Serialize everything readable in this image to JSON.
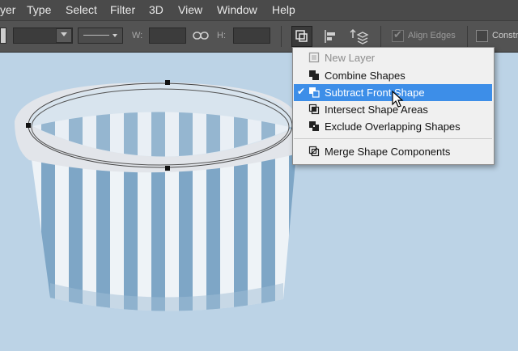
{
  "menubar": {
    "items": [
      "yer",
      "Type",
      "Select",
      "Filter",
      "3D",
      "View",
      "Window",
      "Help"
    ]
  },
  "options_bar": {
    "w_label": "W:",
    "h_label": "H:",
    "align_edges_label": "Align Edges",
    "align_edges_checked": true,
    "constrain_label": "Constr",
    "constrain_checked": false
  },
  "path_operations_menu": {
    "items": [
      {
        "label": "New Layer",
        "icon": "new-layer-icon",
        "disabled": true,
        "checked": false,
        "highlighted": false
      },
      {
        "label": "Combine Shapes",
        "icon": "combine-shapes-icon",
        "disabled": false,
        "checked": false,
        "highlighted": false
      },
      {
        "label": "Subtract Front Shape",
        "icon": "subtract-front-shape-icon",
        "disabled": false,
        "checked": true,
        "highlighted": true
      },
      {
        "label": "Intersect Shape Areas",
        "icon": "intersect-shape-areas-icon",
        "disabled": false,
        "checked": false,
        "highlighted": false
      },
      {
        "label": "Exclude Overlapping Shapes",
        "icon": "exclude-overlapping-shapes-icon",
        "disabled": false,
        "checked": false,
        "highlighted": false
      },
      {
        "label": "Merge Shape Components",
        "icon": "merge-shape-components-icon",
        "disabled": false,
        "checked": false,
        "highlighted": false
      }
    ],
    "check_glyph": "✔"
  },
  "colors": {
    "menubar_bg": "#4a4a4a",
    "options_bg": "#535353",
    "canvas_bg": "#bcd3e6",
    "highlight": "#3d8ee8",
    "stripe_blue": "#7ea6c6",
    "stripe_white": "#eef3f7"
  }
}
